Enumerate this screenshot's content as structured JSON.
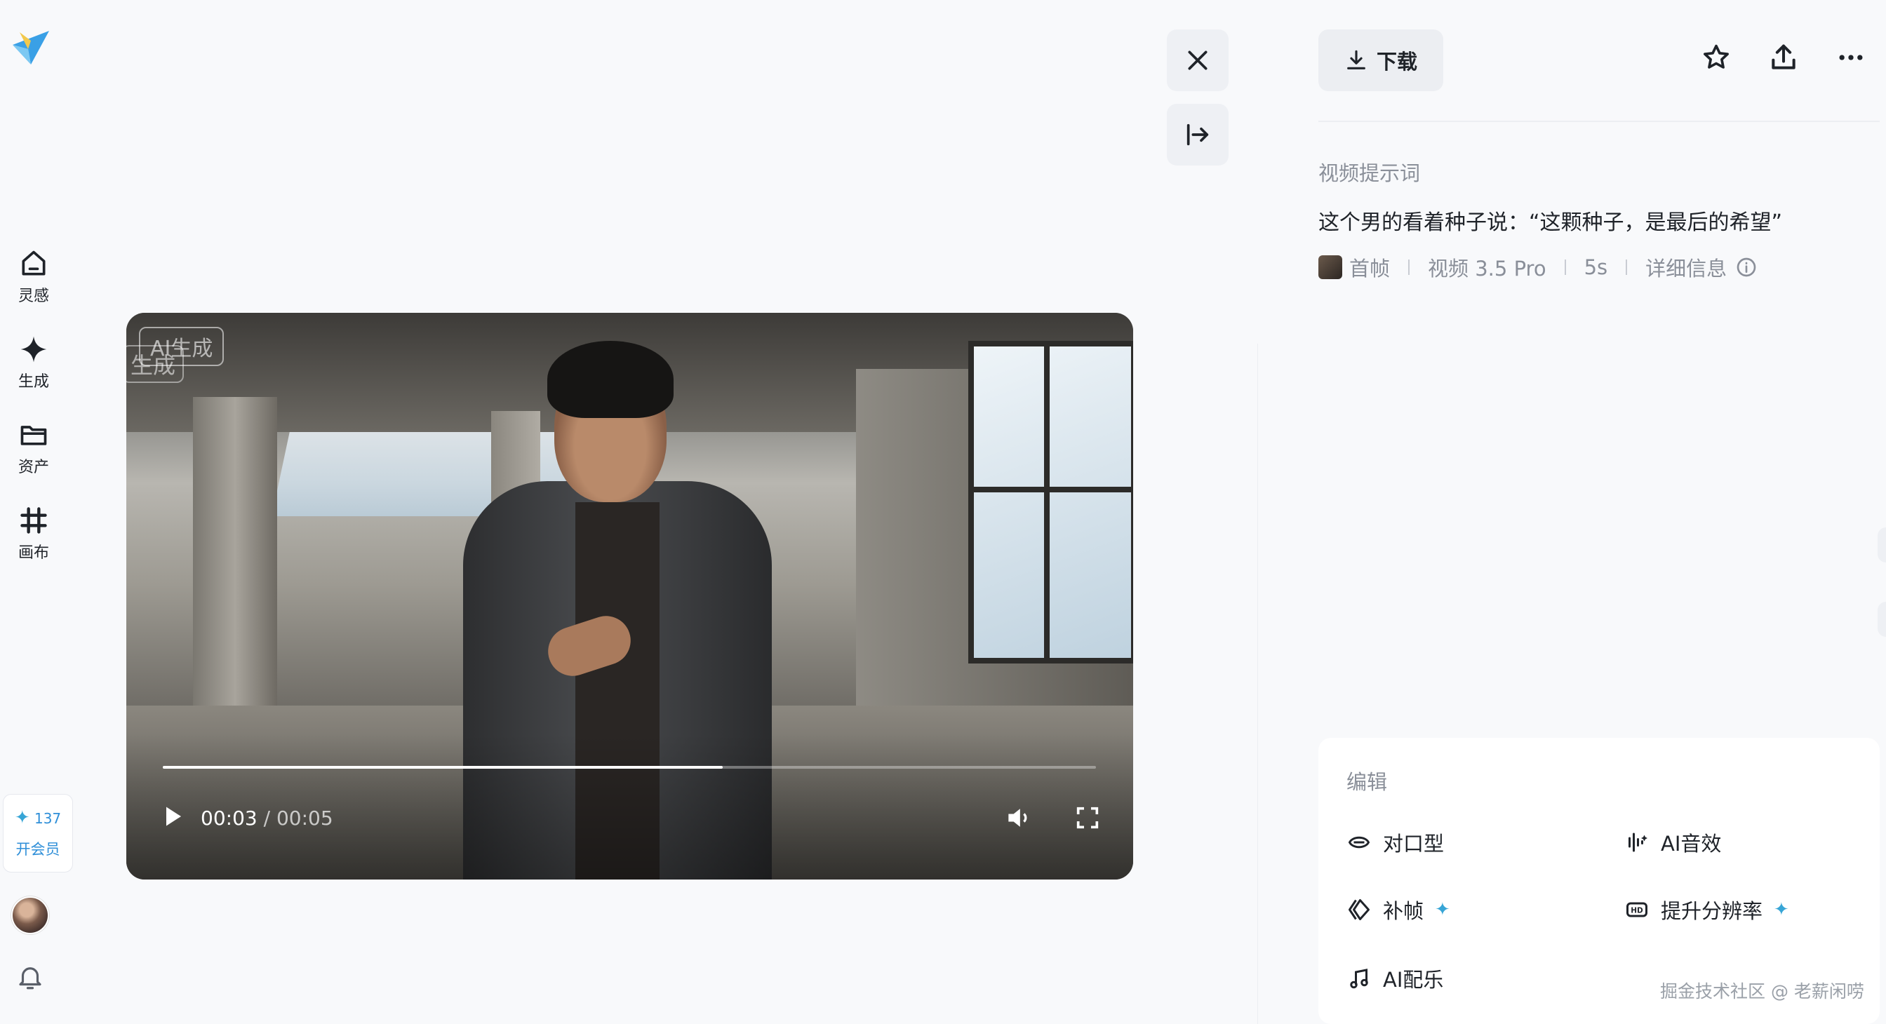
{
  "nav": {
    "items": [
      {
        "label": "灵感",
        "icon": "home-icon"
      },
      {
        "label": "生成",
        "icon": "sparkle-icon"
      },
      {
        "label": "资产",
        "icon": "folder-icon"
      },
      {
        "label": "画布",
        "icon": "canvas-icon"
      }
    ],
    "member": {
      "count": "137",
      "label": "开会员"
    }
  },
  "video": {
    "watermark": "AI生成",
    "watermark2": "生成",
    "current_time": "00:03",
    "total_time": "00:05",
    "time_sep": " / ",
    "progress": 0.6
  },
  "toolbar": {
    "download_label": "下载"
  },
  "detail": {
    "prompt_label": "视频提示词",
    "prompt_text": "这个男的看着种子说：“这颗种子，是最后的希望”",
    "meta": {
      "frame": "首帧",
      "model": "视频 3.5 Pro",
      "duration": "5s",
      "details": "详细信息"
    }
  },
  "edit": {
    "title": "编辑",
    "items": [
      {
        "label": "对口型",
        "icon": "lip-sync-icon"
      },
      {
        "label": "AI音效",
        "icon": "sound-effect-icon"
      },
      {
        "label": "补帧",
        "icon": "frame-interpolation-icon",
        "premium": true
      },
      {
        "label": "提升分辨率",
        "icon": "hd-icon",
        "premium": true
      },
      {
        "label": "AI配乐",
        "icon": "music-note-icon"
      }
    ]
  },
  "footer": {
    "watermark": "掘金技术社区 @ 老薪闲唠"
  },
  "colors": {
    "accent": "#37a5d6",
    "background": "#f8f9fb"
  }
}
